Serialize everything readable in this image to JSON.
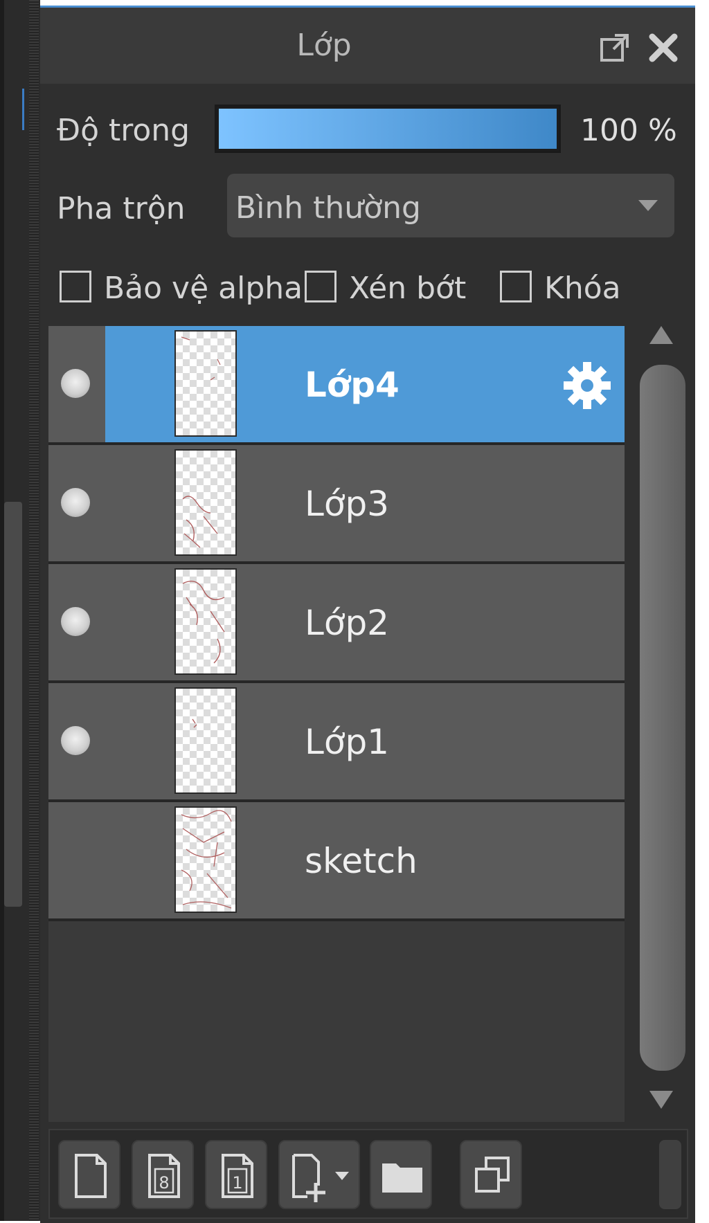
{
  "panel": {
    "title": "Lớp",
    "popout_icon": "popout-icon",
    "close_icon": "close-icon"
  },
  "opacity": {
    "label": "Độ trong",
    "value_text": "100 %",
    "value": 100,
    "fill_color_start": "#7ec3ff",
    "fill_color_end": "#3f88c8"
  },
  "blend": {
    "label": "Pha trộn",
    "selected": "Bình thường"
  },
  "options": [
    {
      "label": "Bảo vệ alpha",
      "checked": false
    },
    {
      "label": "Xén bớt",
      "checked": false
    },
    {
      "label": "Khóa",
      "checked": false
    }
  ],
  "layers": [
    {
      "name": "Lớp4",
      "visible": true,
      "active": true,
      "has_settings": true
    },
    {
      "name": "Lớp3",
      "visible": true,
      "active": false
    },
    {
      "name": "Lớp2",
      "visible": true,
      "active": false
    },
    {
      "name": "Lớp1",
      "visible": true,
      "active": false
    },
    {
      "name": "sketch",
      "visible": false,
      "active": false
    }
  ],
  "colors": {
    "accent": "#4f9ad7",
    "panel_bg": "#2f2f2f",
    "layer_bg": "#5a5a5a"
  },
  "toolbar": {
    "buttons": [
      "new-layer-icon",
      "new-8bit-layer-icon",
      "new-1bit-layer-icon",
      "add-layer-dropdown-icon",
      "new-folder-icon",
      "duplicate-layer-icon"
    ]
  }
}
